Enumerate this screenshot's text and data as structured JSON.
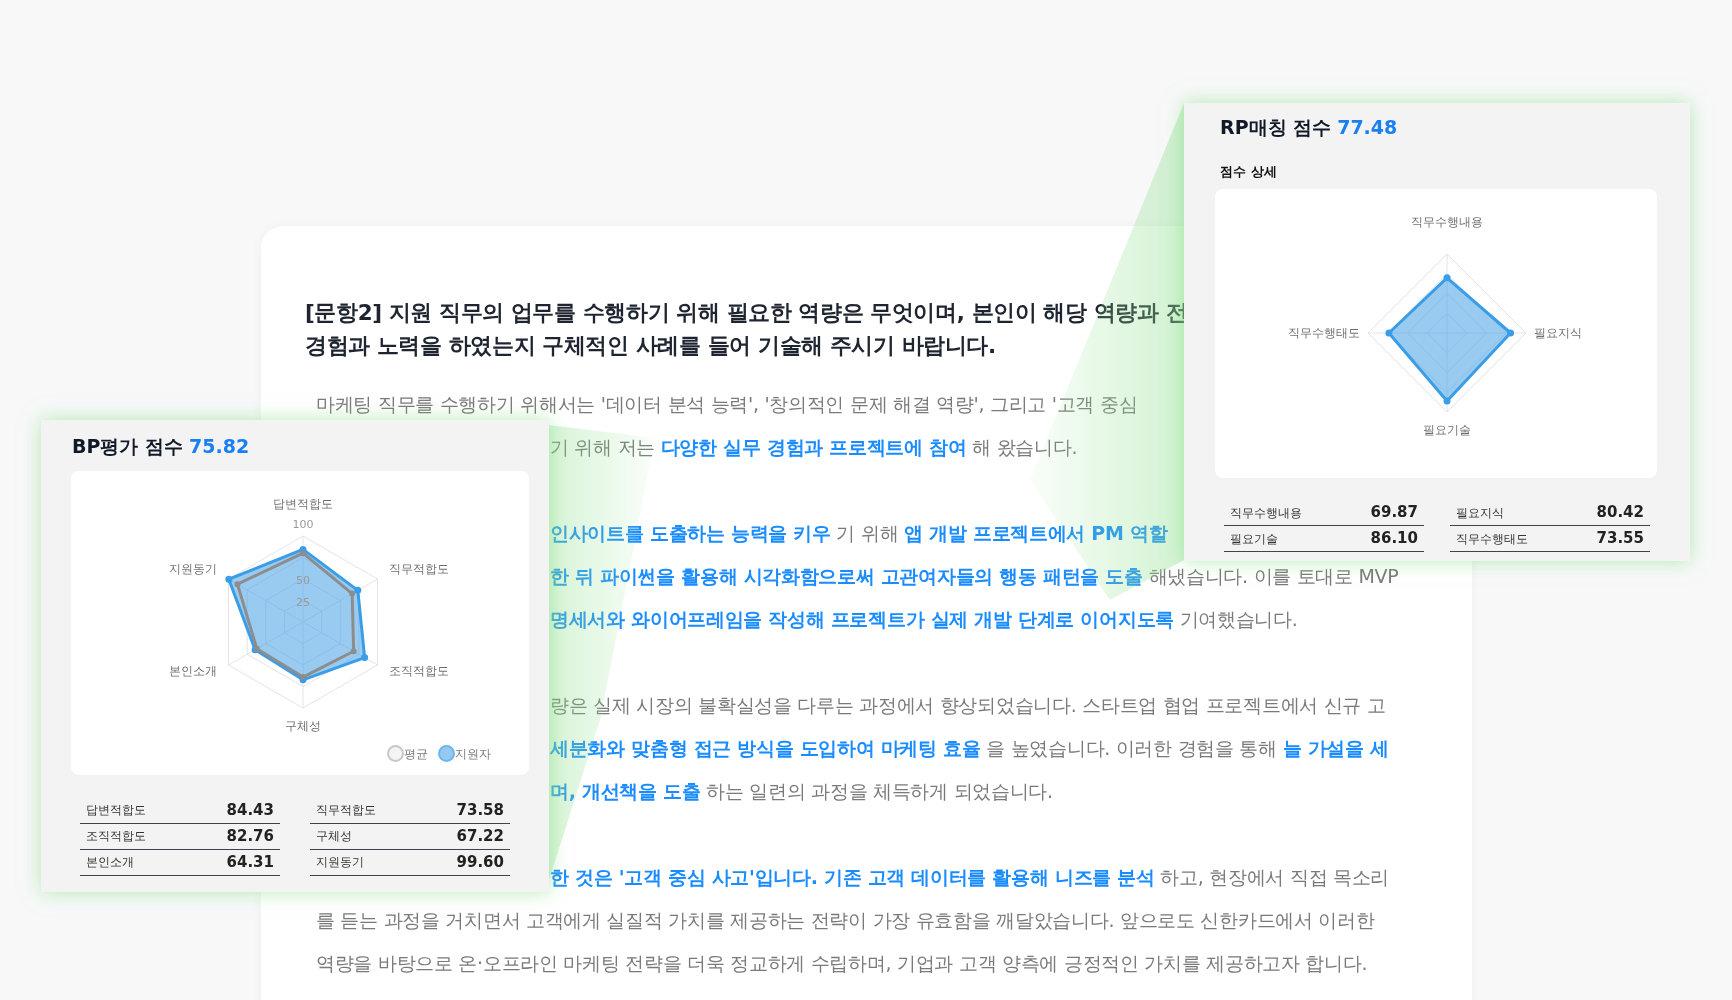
{
  "document": {
    "question_lines": [
      "[문항2] 지원 직무의 업무를 수행하기 위해 필요한 역량은 무엇이며, 본인이 해당 역량과 전",
      "경험과 노력을 하였는지 구체적인 사례를 들어 기술해 주시기 바랍니다."
    ],
    "paragraphs": [
      {
        "lines": [
          {
            "kind": "full",
            "segments": [
              {
                "text": "마케팅 직무를 수행하기 위해서는 '데이터 분석 능력', '창의적인 문제 해결 역량', 그리고 '고객 중심",
                "highlight": false
              }
            ]
          },
          {
            "kind": "continued",
            "segments": [
              {
                "text": "기 위해 저는 ",
                "highlight": false
              },
              {
                "text": "다양한 실무 경험과 프로젝트에 참여",
                "highlight": true
              },
              {
                "text": " 해 왔습니다.",
                "highlight": false
              }
            ]
          }
        ]
      },
      {
        "lines": [
          {
            "kind": "continued",
            "segments": [
              {
                "text": "인사이트를 도출하는 능력을 키우",
                "highlight": true
              },
              {
                "text": " 기 위해 ",
                "highlight": false
              },
              {
                "text": "앱 개발 프로젝트에서 PM 역할",
                "highlight": true
              }
            ]
          },
          {
            "kind": "continued",
            "segments": [
              {
                "text": "한 뒤 파이썬을 활용해 시각화함으로써 고관여자들의 행동 패턴을 도출",
                "highlight": true
              },
              {
                "text": " 해냈습니다. 이를 토대로 MVP",
                "highlight": false
              }
            ]
          },
          {
            "kind": "continued",
            "segments": [
              {
                "text": "명세서와 와이어프레임을 작성해 프로젝트가 실제 개발 단계로 이어지도록",
                "highlight": true
              },
              {
                "text": " 기여했습니다.",
                "highlight": false
              }
            ]
          }
        ]
      },
      {
        "lines": [
          {
            "kind": "continued",
            "segments": [
              {
                "text": "량은 실제 시장의 불확실성을 다루는 과정에서 향상되었습니다. 스타트업 협업 프로젝트에서 신규 고",
                "highlight": false
              }
            ]
          },
          {
            "kind": "continued",
            "segments": [
              {
                "text": "세분화와 맞춤형 접근 방식을 도입하여 마케팅 효율",
                "highlight": true
              },
              {
                "text": " 을 높였습니다. 이러한 경험을 통해 ",
                "highlight": false
              },
              {
                "text": "늘 가설을 세",
                "highlight": true
              }
            ]
          },
          {
            "kind": "continued",
            "segments": [
              {
                "text": "며, 개선책을 도출",
                "highlight": true
              },
              {
                "text": " 하는 일련의 과정을 체득하게 되었습니다.",
                "highlight": false
              }
            ]
          }
        ]
      },
      {
        "lines": [
          {
            "kind": "continued",
            "segments": [
              {
                "text": "한 것은 '고객 중심 사고'입니다. 기존 고객 데이터를 활용해 니즈를 분석",
                "highlight": true
              },
              {
                "text": " 하고, 현장에서 직접 목소리",
                "highlight": false
              }
            ]
          },
          {
            "kind": "full",
            "segments": [
              {
                "text": "를 듣는 과정을 거치면서 고객에게 실질적 가치를 제공하는 전략이 가장 유효함을 깨달았습니다. 앞으로도 신한카드에서 이러한",
                "highlight": false
              }
            ]
          },
          {
            "kind": "full",
            "segments": [
              {
                "text": "역량을 바탕으로 온·오프라인 마케팅 전략을 더욱 정교하게 수립하며, 기업과 고객 양측에 긍정적인 가치를 제공하고자 합니다.",
                "highlight": false
              }
            ]
          }
        ]
      }
    ]
  },
  "bp_card": {
    "title": "BP평가 점수",
    "score": "75.82",
    "chart": {
      "axes": [
        "답변적합도",
        "직무적합도",
        "조직적합도",
        "구체성",
        "본인소개",
        "지원동기"
      ],
      "ticks": [
        "100",
        "50",
        "25"
      ],
      "legend": [
        {
          "kind": "average",
          "label": "평균"
        },
        {
          "kind": "applicant",
          "label": "지원자"
        }
      ]
    },
    "scores": [
      {
        "label": "답변적합도",
        "value": "84.43"
      },
      {
        "label": "직무적합도",
        "value": "73.58"
      },
      {
        "label": "조직적합도",
        "value": "82.76"
      },
      {
        "label": "구체성",
        "value": "67.22"
      },
      {
        "label": "본인소개",
        "value": "64.31"
      },
      {
        "label": "지원동기",
        "value": "99.60"
      }
    ]
  },
  "rp_card": {
    "title": "RP매칭 점수",
    "score": "77.48",
    "subtitle": "점수 상세",
    "chart": {
      "axes": [
        "직무수행내용",
        "필요지식",
        "필요기술",
        "직무수행태도"
      ]
    },
    "scores": [
      {
        "label": "직무수행내용",
        "value": "69.87"
      },
      {
        "label": "필요지식",
        "value": "80.42"
      },
      {
        "label": "필요기술",
        "value": "86.10"
      },
      {
        "label": "직무수행태도",
        "value": "73.55"
      }
    ]
  }
}
